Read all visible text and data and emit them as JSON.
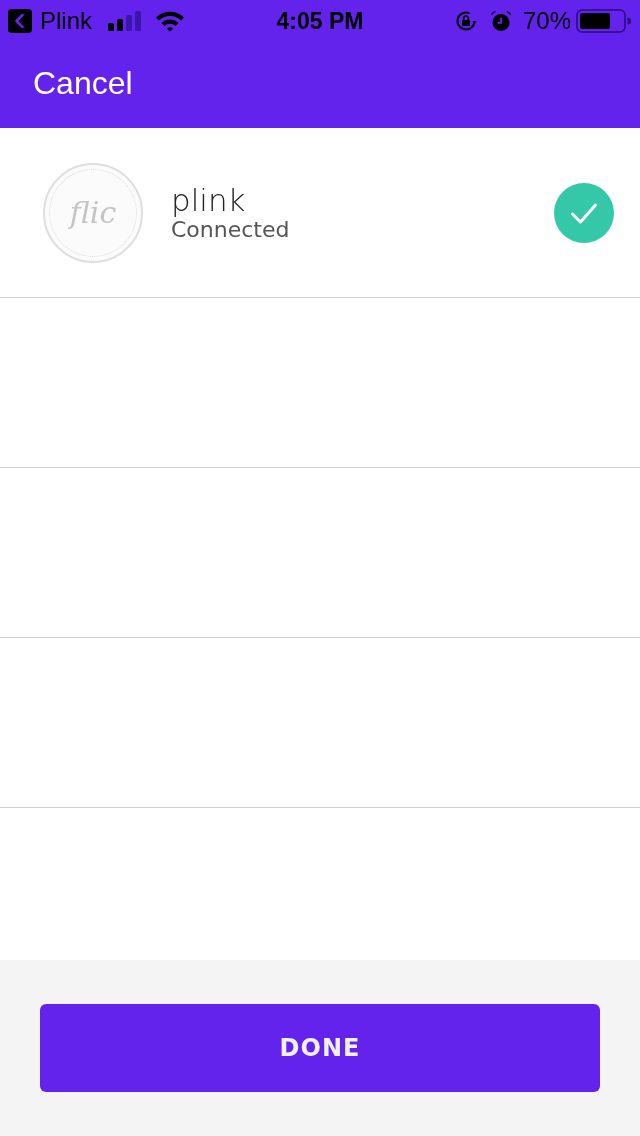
{
  "status_bar": {
    "back_app": "Plink",
    "time": "4:05 PM",
    "battery_percent": "70%"
  },
  "nav": {
    "cancel": "Cancel"
  },
  "devices": [
    {
      "logo_text": "flic",
      "name": "plink",
      "status": "Connected",
      "connected": true
    }
  ],
  "footer": {
    "button": "DONE"
  }
}
